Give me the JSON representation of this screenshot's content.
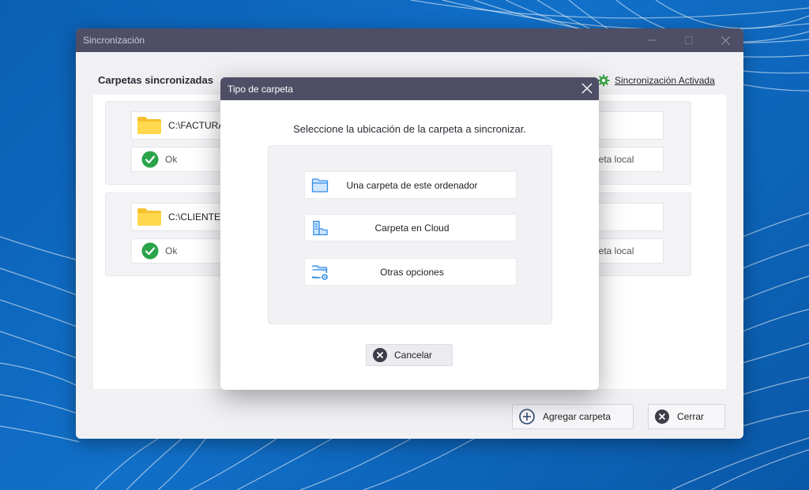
{
  "main_window": {
    "title": "Sincronización",
    "section_title": "Carpetas sincronizadas",
    "sync_status_link": "Sincronización Activada",
    "folders": [
      {
        "path": "C:\\FACTURA",
        "status": "Ok",
        "right_label": "rpeta local"
      },
      {
        "path": "C:\\CLIENTES",
        "status": "Ok",
        "right_label": "rpeta local"
      }
    ],
    "add_folder_label": "Agregar carpeta",
    "close_label": "Cerrar"
  },
  "modal": {
    "title": "Tipo de carpeta",
    "prompt": "Seleccione la ubicación de la carpeta a sincronizar.",
    "options": [
      {
        "label": "Una carpeta de este ordenador",
        "icon": "folder-icon"
      },
      {
        "label": "Carpeta en Cloud",
        "icon": "cloud-folder-icon"
      },
      {
        "label": "Otras opciones",
        "icon": "folder-settings-icon"
      }
    ],
    "cancel_label": "Cancelar"
  },
  "colors": {
    "titlebar": "#4e4e66",
    "accent_blue": "#2f8be6",
    "ok_green": "#2aa34a",
    "gear_green": "#3aa647",
    "folder_yellow": "#f5c22e",
    "desktop_blue": "#0b5fb3"
  }
}
